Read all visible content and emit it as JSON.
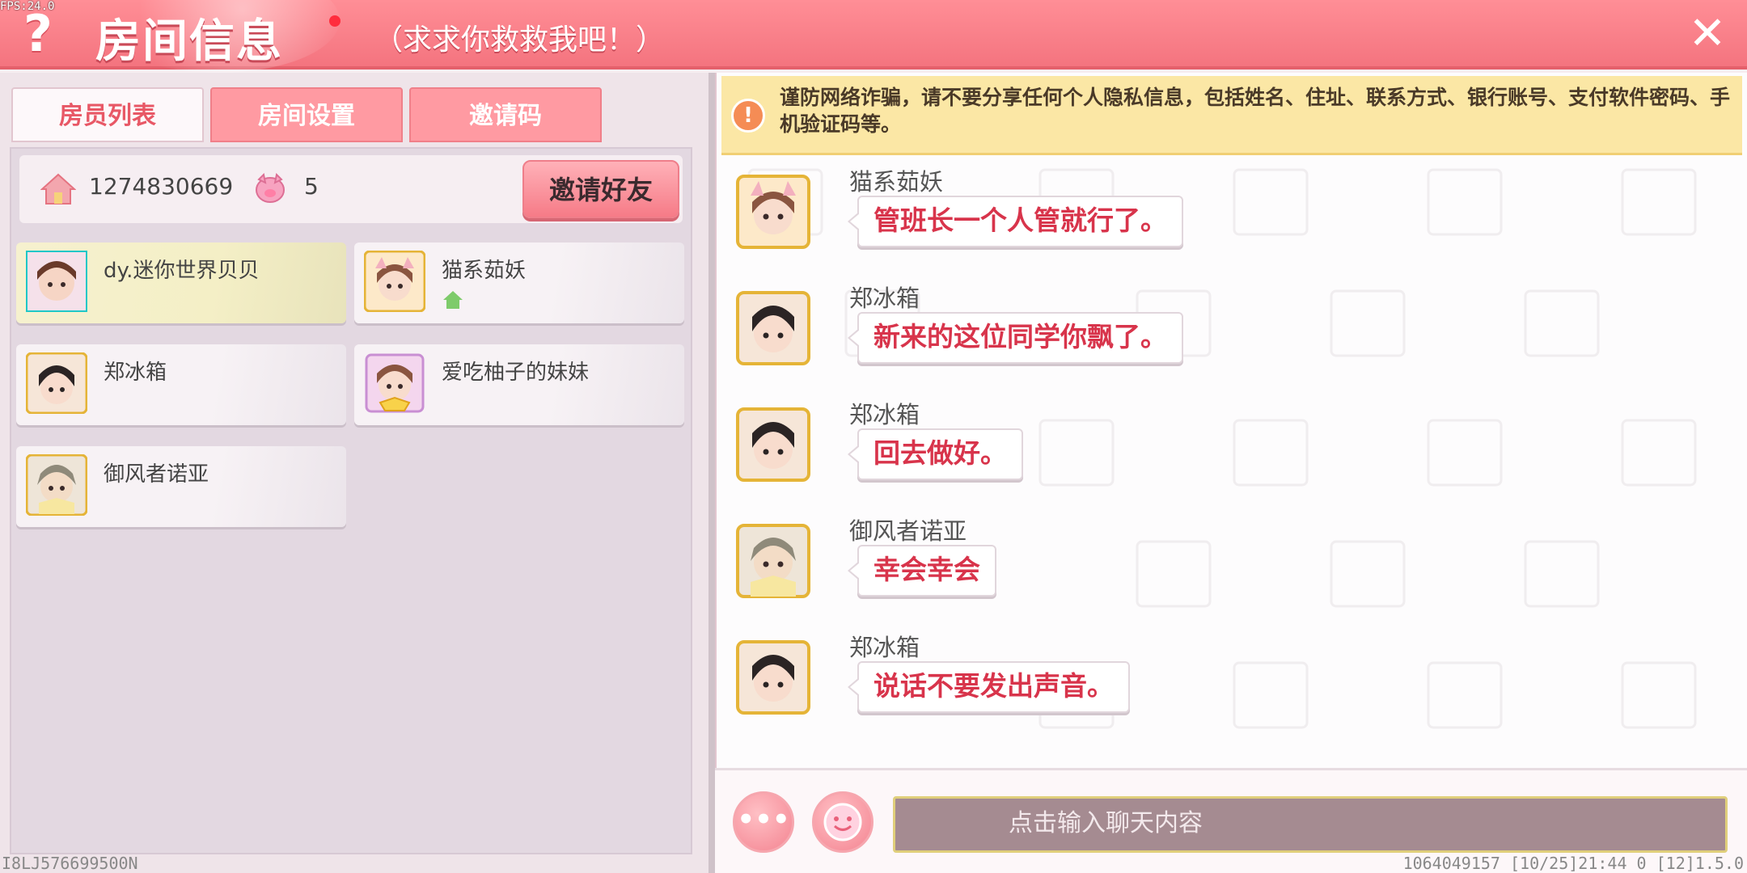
{
  "fps": "FPS:24.0",
  "header": {
    "title": "房间信息",
    "subtitle": "（求求你救救我吧！）",
    "help_icon": "question-mark-icon",
    "close_icon": "close-x-icon"
  },
  "tabs": [
    {
      "label": "房员列表",
      "active": true
    },
    {
      "label": "房间设置",
      "active": false
    },
    {
      "label": "邀请码",
      "active": false
    }
  ],
  "room": {
    "id": "1274830669",
    "member_count": "5",
    "invite_button": "邀请好友"
  },
  "members": [
    {
      "name": "dy.迷你世界贝贝",
      "self": true
    },
    {
      "name": "猫系茹妖",
      "is_host": true
    },
    {
      "name": "郑冰箱"
    },
    {
      "name": "爱吃柚子的妹妹"
    },
    {
      "name": "御风者诺亚"
    }
  ],
  "warning": "谨防网络诈骗，请不要分享任何个人隐私信息，包括姓名、住址、联系方式、银行账号、支付软件密码、手机验证码等。",
  "messages": [
    {
      "sender": "猫系茹妖",
      "text": "管班长一个人管就行了。"
    },
    {
      "sender": "郑冰箱",
      "text": "新来的这位同学你飘了。"
    },
    {
      "sender": "郑冰箱",
      "text": "回去做好。"
    },
    {
      "sender": "御风者诺亚",
      "text": "幸会幸会"
    },
    {
      "sender": "郑冰箱",
      "text": "说话不要发出声音。"
    }
  ],
  "input": {
    "placeholder": "点击输入聊天内容",
    "more_button": "•••",
    "emoji_icon": "smiley-face-icon"
  },
  "footer": {
    "left_code": "I8LJ576699500N",
    "right_info": "1064049157   [10/25]21:44 0   [12]1.5.0"
  },
  "colors": {
    "accent": "#f4747f",
    "message_text": "#d8344b",
    "warning_bg": "#fbe7a5"
  }
}
